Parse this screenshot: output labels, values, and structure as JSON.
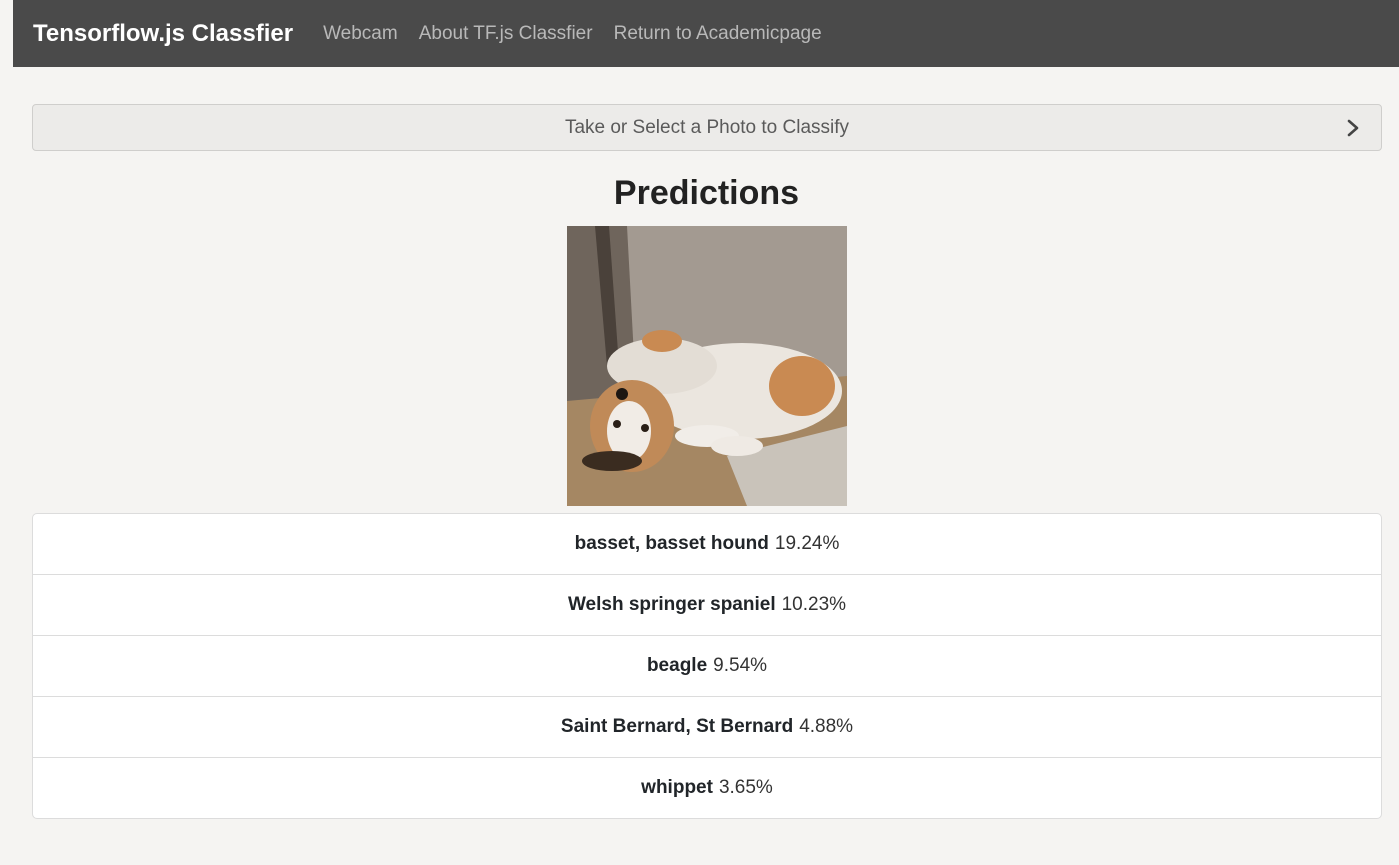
{
  "navbar": {
    "brand": "Tensorflow.js Classfier",
    "links": [
      "Webcam",
      "About TF.js Classfier",
      "Return to Academicpage"
    ]
  },
  "select_bar": {
    "label": "Take or Select a Photo to Classify",
    "icon": "chevron-right-icon"
  },
  "main": {
    "title": "Predictions",
    "photo_alt": "dog photo"
  },
  "predictions": [
    {
      "class": "basset, basset hound",
      "prob": "19.24%"
    },
    {
      "class": "Welsh springer spaniel",
      "prob": "10.23%"
    },
    {
      "class": "beagle",
      "prob": "9.54%"
    },
    {
      "class": "Saint Bernard, St Bernard",
      "prob": "4.88%"
    },
    {
      "class": "whippet",
      "prob": "3.65%"
    }
  ],
  "colors": {
    "navbar_bg": "#4a4a4a",
    "page_bg": "#f5f4f2",
    "brand_text": "#ffffff",
    "nav_link_text": "#b9b9b9"
  }
}
